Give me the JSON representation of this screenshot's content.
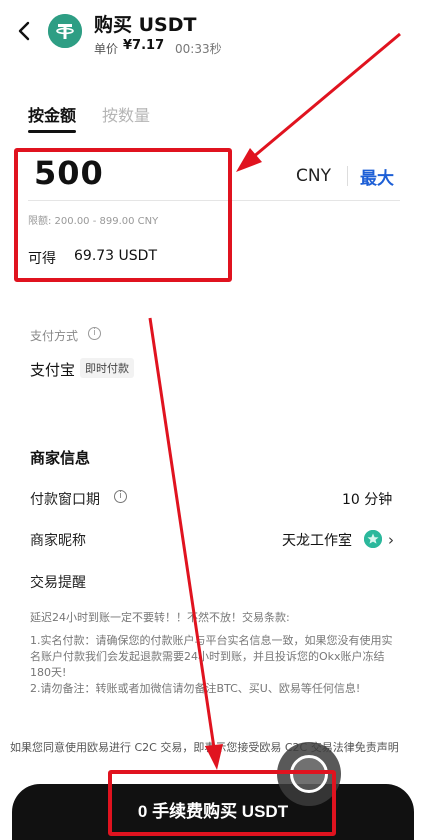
{
  "header": {
    "title": "购买 USDT",
    "price_label": "单价",
    "price_value": "¥7.17",
    "countdown": "00:33秒"
  },
  "tabs": [
    {
      "label": "按金额",
      "active": true
    },
    {
      "label": "按数量",
      "active": false
    }
  ],
  "amount": {
    "value": "500",
    "currency": "CNY",
    "max_label": "最大",
    "limit_text": "限额: 200.00 - 899.00 CNY",
    "receive_label": "可得",
    "receive_value": "69.73 USDT"
  },
  "payment": {
    "label": "支付方式",
    "method": "支付宝",
    "tag": "即时付款"
  },
  "merchant": {
    "title": "商家信息",
    "window_label": "付款窗口期",
    "window_value": "10 分钟",
    "nickname_label": "商家昵称",
    "nickname_value": "天龙工作室",
    "remind_label": "交易提醒"
  },
  "terms": {
    "intro": "延迟24小时到账一定不要转！！不然不放！交易条款:",
    "item1": "1.实名付款：请确保您的付款账户与平台实名信息一致，如果您没有使用实名账户付款我们会发起退款需要24小时到账，并且投诉您的Okx账户冻结180天!",
    "item2": "2.请勿备注：转账或者加微信请勿备注BTC、买U、欧易等任何信息!"
  },
  "agreement": "如果您同意使用欧易进行 C2C 交易，即表示您接受欧易 C2C 交易法律免责声明",
  "buy_button": "0 手续费购买 USDT",
  "colors": {
    "accent_blue": "#1d5fd6",
    "highlight_red": "#e0131f",
    "coin_green": "#2e9e84",
    "button_black": "#111111"
  }
}
